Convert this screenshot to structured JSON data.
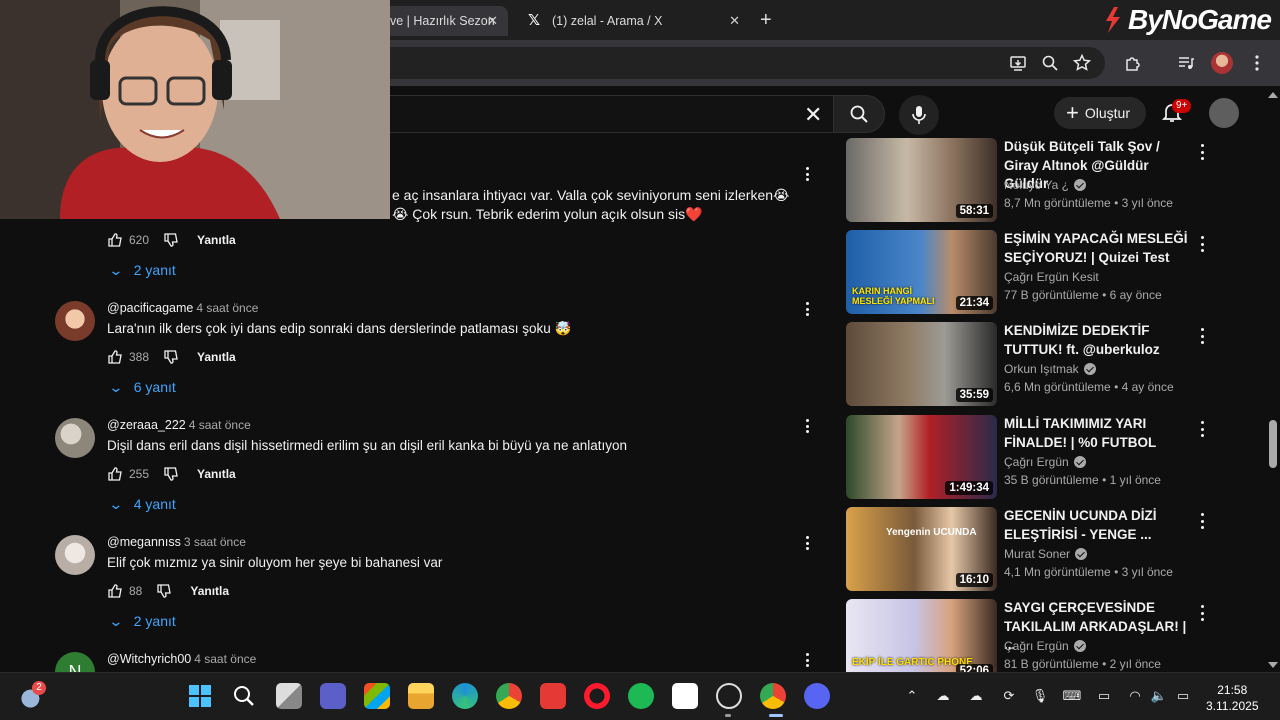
{
  "browser": {
    "tabs": [
      {
        "label": "ve | Hazırlık Sezon",
        "active": true
      },
      {
        "label": "(1) zelal - Arama / X",
        "active": false
      }
    ],
    "brand": "ByNoGame"
  },
  "header": {
    "create_label": "Oluştur",
    "notification_badge": "9+"
  },
  "comments": {
    "partial": {
      "text": "e aç insanlara ihtiyacı var. Valla çok seviniyorum seni izlerken😭 😭 Çok rsun. Tebrik ederim yolun açık olsun sis❤️",
      "likes": "620",
      "reply_label": "Yanıtla",
      "replies": "2 yanıt"
    },
    "items": [
      {
        "user": "@pacificagame",
        "time": "4 saat önce",
        "text": "Lara'nın ilk ders çok iyi dans edip sonraki dans derslerinde patlaması şoku 🤯",
        "likes": "388",
        "reply_label": "Yanıtla",
        "replies": "6 yanıt"
      },
      {
        "user": "@zeraaa_222",
        "time": "4 saat önce",
        "text": "Dişil dans eril dans dişil hissetirmedi erilim şu an dişil eril kanka bi büyü ya ne anlatıyon",
        "likes": "255",
        "reply_label": "Yanıtla",
        "replies": "4 yanıt"
      },
      {
        "user": "@megannıss",
        "time": "3 saat önce",
        "text": "Elif çok mızmız ya sinir oluyom her şeye bi bahanesi var",
        "likes": "88",
        "reply_label": "Yanıtla",
        "replies": "2 yanıt"
      },
      {
        "user": "@Witchyrich00",
        "time": "4 saat önce",
        "avatar_letter": "N"
      }
    ]
  },
  "recommendations": [
    {
      "title": "Düşük Bütçeli Talk Şov / Giray Altınok @Güldür Güldür",
      "channel": "Noluyo Ya ¿",
      "verified": true,
      "meta": "8,7 Mn görüntüleme • 3 yıl önce",
      "duration": "58:31",
      "thumb_text": ""
    },
    {
      "title": "EŞİMİN YAPACAĞI MESLEĞİ SEÇİYORUZ! | Quizei Test",
      "channel": "Çağrı Ergün Kesit",
      "verified": false,
      "meta": "77 B görüntüleme • 6 ay önce",
      "duration": "21:34",
      "thumb_text": "KARIN HANGİ MESLEĞİ YAPMALI"
    },
    {
      "title": "KENDİMİZE DEDEKTİF TUTTUK! ft. @uberkuloz",
      "channel": "Orkun Işıtmak",
      "verified": true,
      "meta": "6,6 Mn görüntüleme • 4 ay önce",
      "duration": "35:59",
      "thumb_text": ""
    },
    {
      "title": "MİLLİ TAKIMIMIZ YARI FİNALDE! | %0 FUTBOL",
      "channel": "Çağrı Ergün",
      "verified": true,
      "meta": "35 B görüntüleme • 1 yıl önce",
      "duration": "1:49:34",
      "thumb_text": ""
    },
    {
      "title": "GECENİN UCUNDA DİZİ ELEŞTİRİSİ - YENGE ...",
      "channel": "Murat Soner",
      "verified": true,
      "meta": "4,1 Mn görüntüleme • 3 yıl önce",
      "duration": "16:10",
      "thumb_text": "Yengenin UCUNDA"
    },
    {
      "title": "SAYGI ÇERÇEVESİNDE TAKILALIM ARKADAŞLAR! | ...",
      "channel": "Çağrı Ergün",
      "verified": true,
      "meta": "81 B görüntüleme • 2 yıl önce",
      "duration": "52:06",
      "thumb_text": "EKİP İLE GARTIC PHONE"
    }
  ],
  "taskbar": {
    "time": "21:58",
    "date": "3.11.2025",
    "weather_badge": "2"
  },
  "colors": {
    "link_blue": "#3ea6ff",
    "youtube_red": "#cc0000",
    "background": "#0f0f0f"
  }
}
